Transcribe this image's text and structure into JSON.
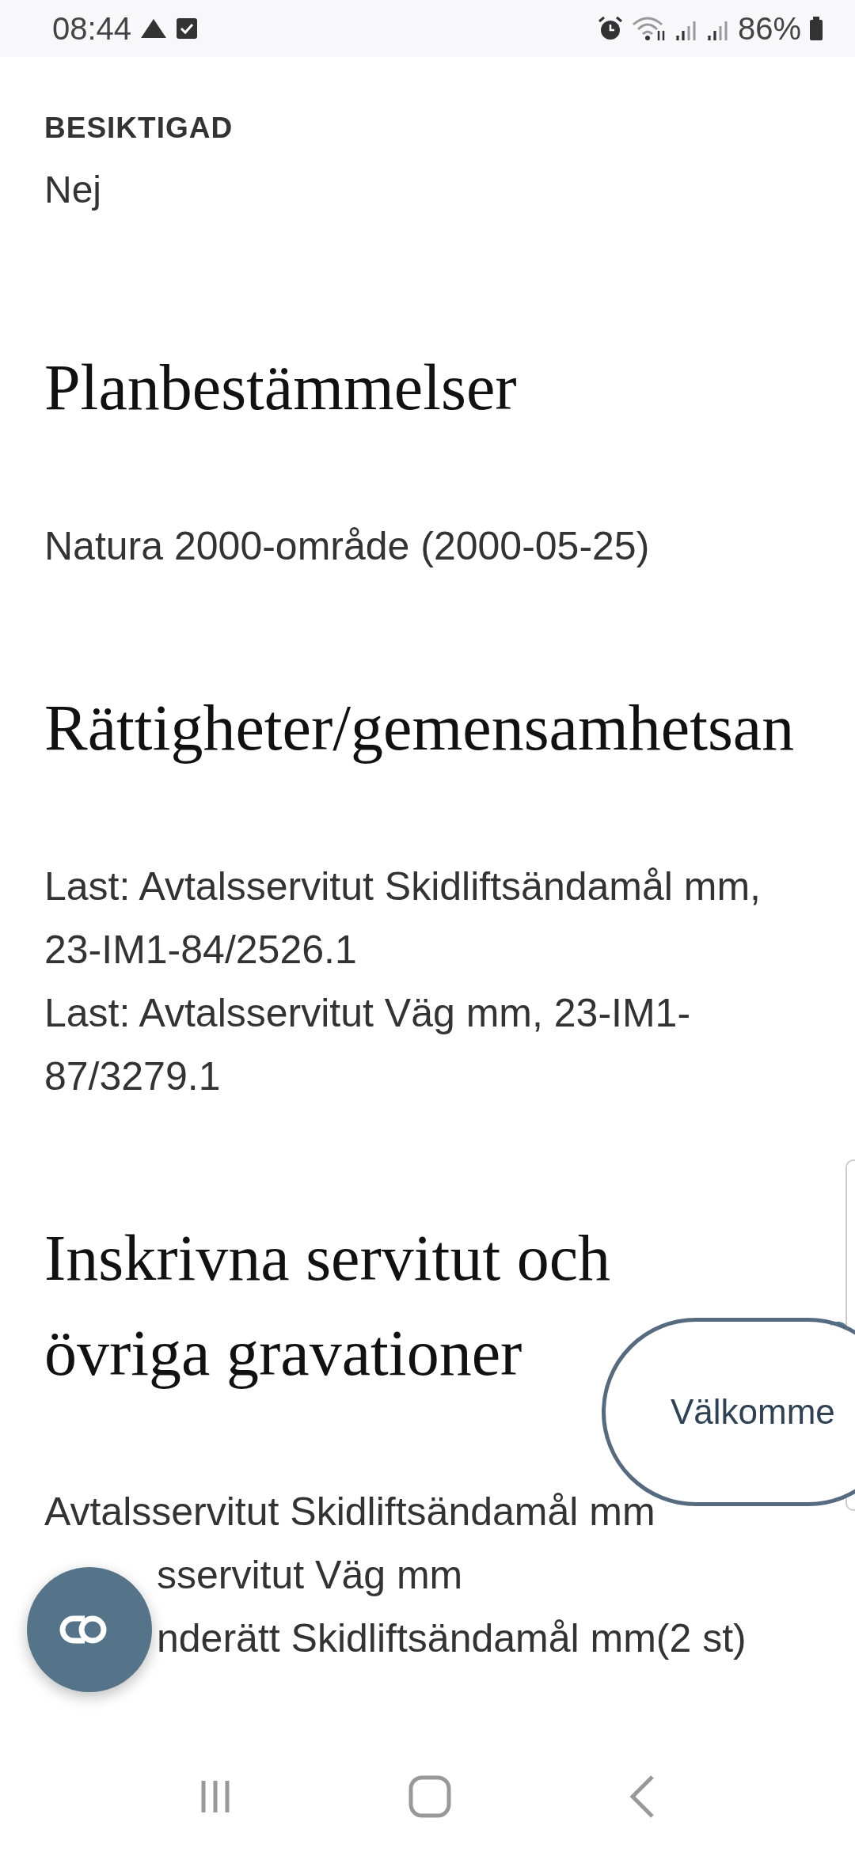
{
  "status_bar": {
    "time": "08:44",
    "battery": "86%"
  },
  "fields": [
    {
      "label": "BESIKTIGAD",
      "value": "Nej"
    }
  ],
  "sections": [
    {
      "heading": "Planbestämmelser",
      "lines": [
        "Natura 2000-område (2000-05-25)"
      ]
    },
    {
      "heading": "Rättigheter/gemensamhetsan",
      "lines": [
        "Last: Avtalsservitut Skidliftsändamål mm, 23-IM1-84/2526.1",
        "Last: Avtalsservitut Väg mm, 23-IM1-87/3279.1"
      ]
    },
    {
      "heading": "Inskrivna servitut och övriga gravationer",
      "lines": [
        "Avtalsservitut Skidliftsändamål mm",
        "sservitut Väg mm",
        "nderätt Skidliftsändamål mm(2 st)"
      ]
    }
  ],
  "chat_bubble": {
    "text": "Välkomme"
  }
}
